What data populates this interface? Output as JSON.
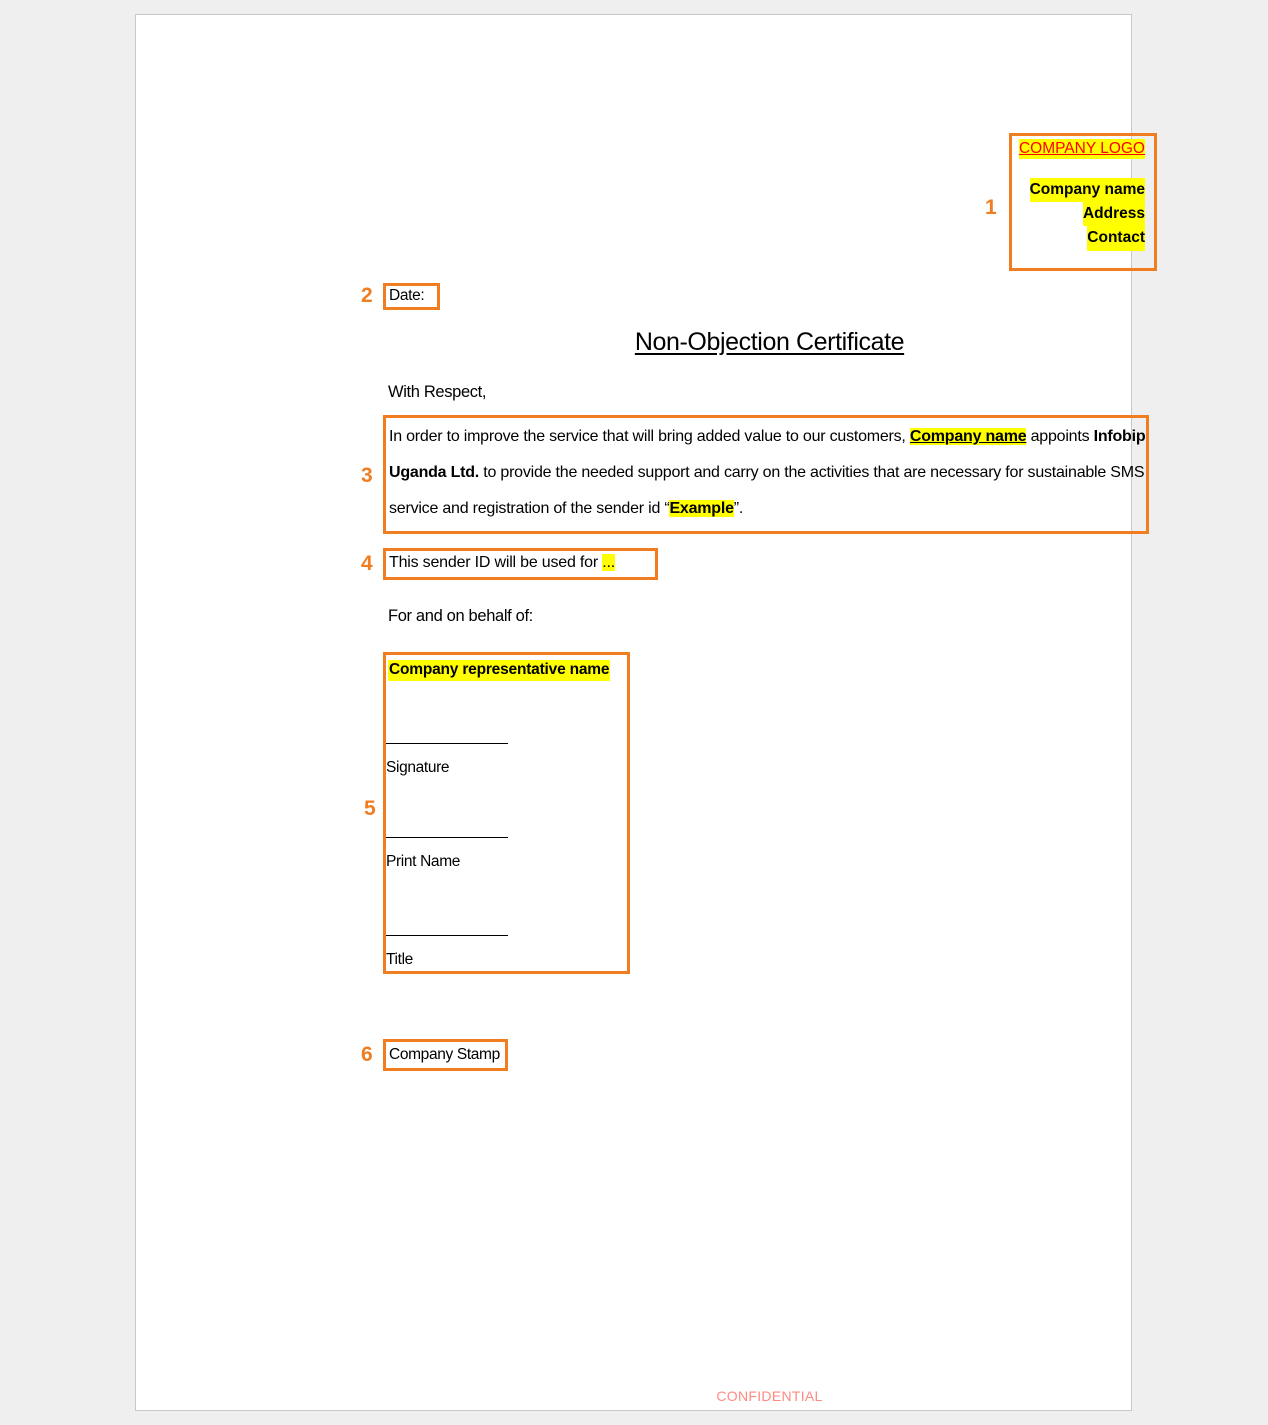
{
  "document": {
    "title": "Non-Objection Certificate",
    "salutation": "With Respect,",
    "behalf_label": "For and on behalf of:",
    "footer": "CONFIDENTIAL"
  },
  "annotations": {
    "one": "1",
    "two": "2",
    "three": "3",
    "four": "4",
    "five": "5",
    "six": "6",
    "color": "#F07D20"
  },
  "logo_block": {
    "logo_placeholder": "COMPANY LOGO",
    "company_name": "Company name",
    "address": "Address",
    "contact": "Contact",
    "logo_text_color": "#FF0000",
    "highlight_color": "#FFFF00"
  },
  "date_field": {
    "label": "Date:",
    "value": ""
  },
  "paragraph": {
    "part1": "In order to improve the service that will bring added value to our customers, ",
    "company_name_placeholder": "Company  name",
    "part2": " appoints ",
    "provider": "Infobip Uganda Ltd.",
    "part3": " to provide the needed support and carry on the activities that are necessary for sustainable SMS service and registration of the sender id “",
    "sender_id_placeholder": "Example",
    "part4": "”."
  },
  "usage_line": {
    "text": "This sender ID will be used for ",
    "placeholder": "..."
  },
  "signature_block": {
    "representative_name": "Company representative name",
    "signature_label": "Signature",
    "print_name_label": "Print Name",
    "title_label": "Title"
  },
  "stamp": {
    "label": "Company Stamp"
  }
}
